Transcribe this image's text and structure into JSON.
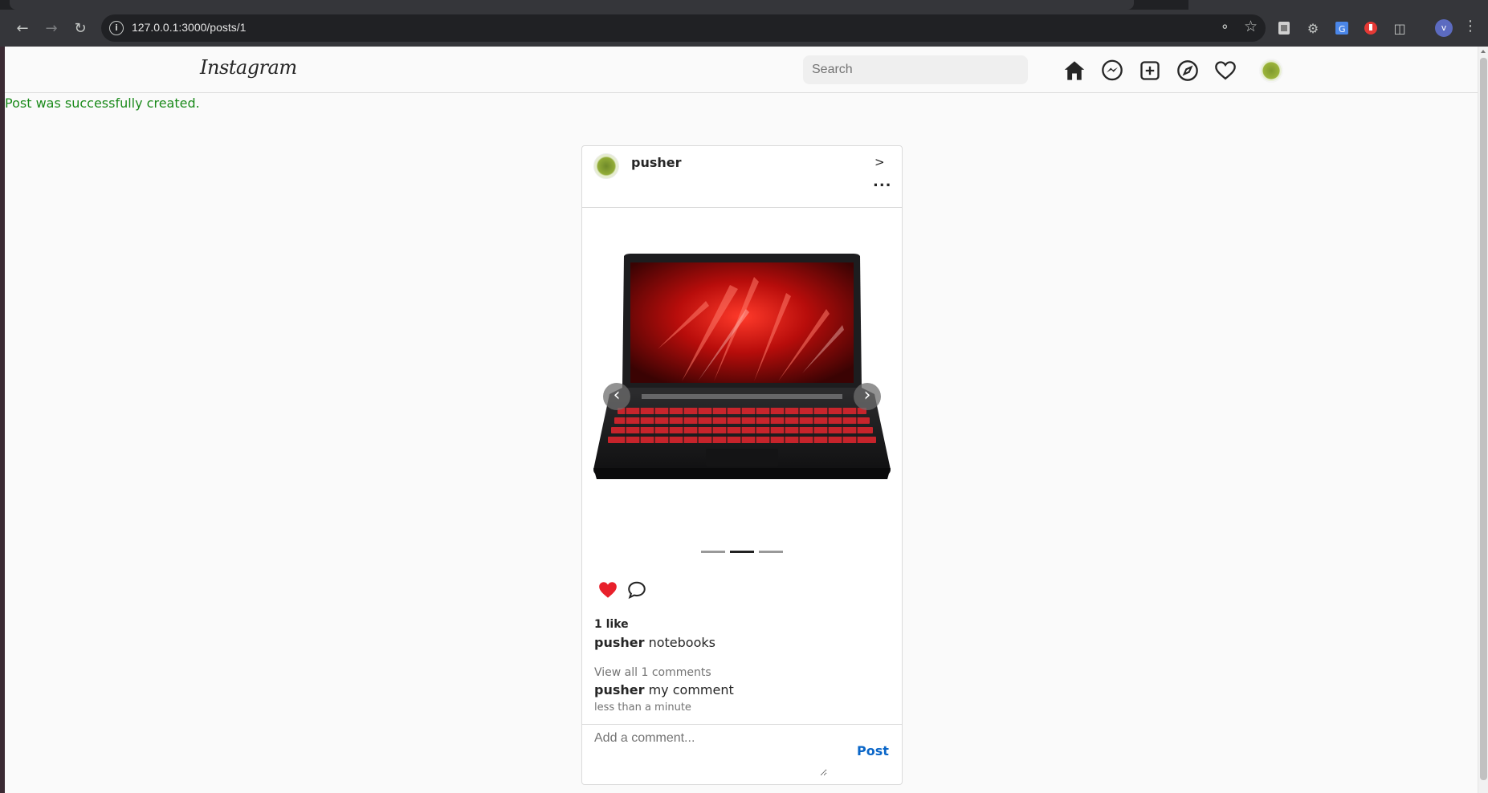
{
  "browser": {
    "url": "127.0.0.1:3000/posts/1",
    "profile_initial": "v"
  },
  "header": {
    "logo": "Instagram",
    "search_placeholder": "Search"
  },
  "notice": "Post was successfully created.",
  "post": {
    "username": "pusher",
    "next_label": ">",
    "more_label": "...",
    "carousel": {
      "slide_count": 3,
      "active_index": 1
    },
    "likes": "1 like",
    "caption_user": "pusher",
    "caption_text": "notebooks",
    "view_all": "View all 1 comments",
    "comment_user": "pusher",
    "comment_text": "my comment",
    "time": "less than a minute",
    "comment_placeholder": "Add a comment...",
    "post_button": "Post",
    "liked": true
  },
  "colors": {
    "notice": "#1a8a1a",
    "like": "#e8202b",
    "post_button": "#0a66c8"
  }
}
